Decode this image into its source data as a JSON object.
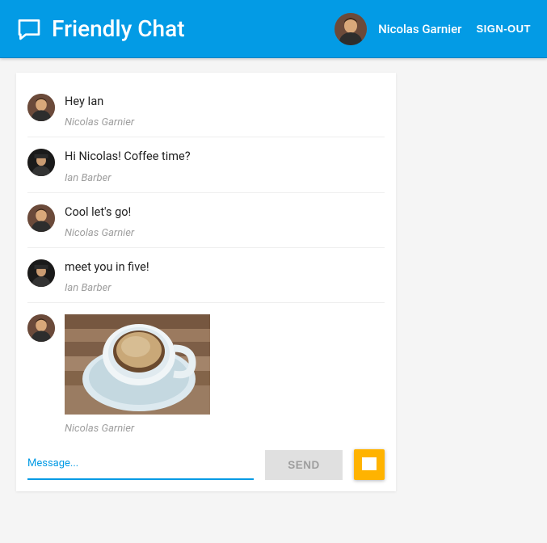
{
  "header": {
    "title": "Friendly Chat",
    "user_name": "Nicolas Garnier",
    "signout_label": "SIGN-OUT"
  },
  "messages": [
    {
      "text": "Hey Ian",
      "sender": "Nicolas Garnier",
      "avatar": "nicolas",
      "type": "text"
    },
    {
      "text": "Hi Nicolas! Coffee time?",
      "sender": "Ian Barber",
      "avatar": "ian",
      "type": "text"
    },
    {
      "text": "Cool let's go!",
      "sender": "Nicolas Garnier",
      "avatar": "nicolas",
      "type": "text"
    },
    {
      "text": "meet you in five!",
      "sender": "Ian Barber",
      "avatar": "ian",
      "type": "text"
    },
    {
      "image": "coffee-cup",
      "sender": "Nicolas Garnier",
      "avatar": "nicolas",
      "type": "image"
    }
  ],
  "composer": {
    "placeholder": "Message...",
    "value": "",
    "send_label": "SEND"
  }
}
